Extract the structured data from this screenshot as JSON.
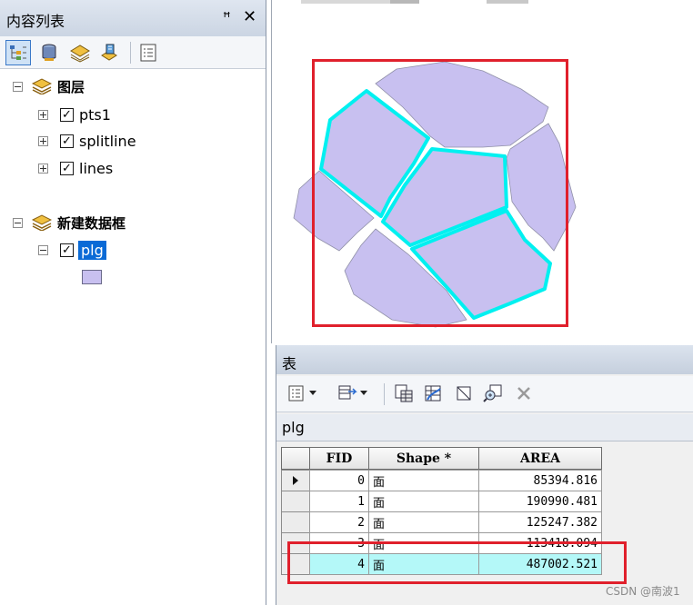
{
  "toc": {
    "title": "内容列表",
    "pin_glyph": "ꟸ",
    "close_glyph": "✕",
    "toolbar_icons": [
      "list-by-drawing-order-icon",
      "list-by-source-icon",
      "list-by-visibility-icon",
      "list-by-selection-icon",
      "options-icon"
    ],
    "groups": [
      {
        "label": "图层",
        "expanded": true,
        "layers": [
          {
            "label": "pts1",
            "checked": true
          },
          {
            "label": "splitline",
            "checked": true
          },
          {
            "label": "lines",
            "checked": true
          }
        ]
      },
      {
        "label": "新建数据框",
        "expanded": true,
        "layers": [
          {
            "label": "plg",
            "checked": true,
            "selected": true,
            "symbol_color": "#c8c0f0"
          }
        ]
      }
    ]
  },
  "table_window": {
    "title": "表",
    "tab": "plg",
    "columns": [
      "FID",
      "Shape *",
      "AREA"
    ],
    "rows": [
      {
        "fid": "0",
        "shape": "面",
        "area": "85394.816",
        "current": true
      },
      {
        "fid": "1",
        "shape": "面",
        "area": "190990.481"
      },
      {
        "fid": "2",
        "shape": "面",
        "area": "125247.382"
      },
      {
        "fid": "3",
        "shape": "面",
        "area": "113418.094"
      },
      {
        "fid": "4",
        "shape": "面",
        "area": "487002.521",
        "selected": true
      }
    ]
  },
  "colors": {
    "polygon_fill": "#c8c0f0",
    "selection_outline": "#00f0f0",
    "highlight_box": "#e0202c",
    "selected_row": "#b4f8f8"
  },
  "watermark": "CSDN @南波1"
}
